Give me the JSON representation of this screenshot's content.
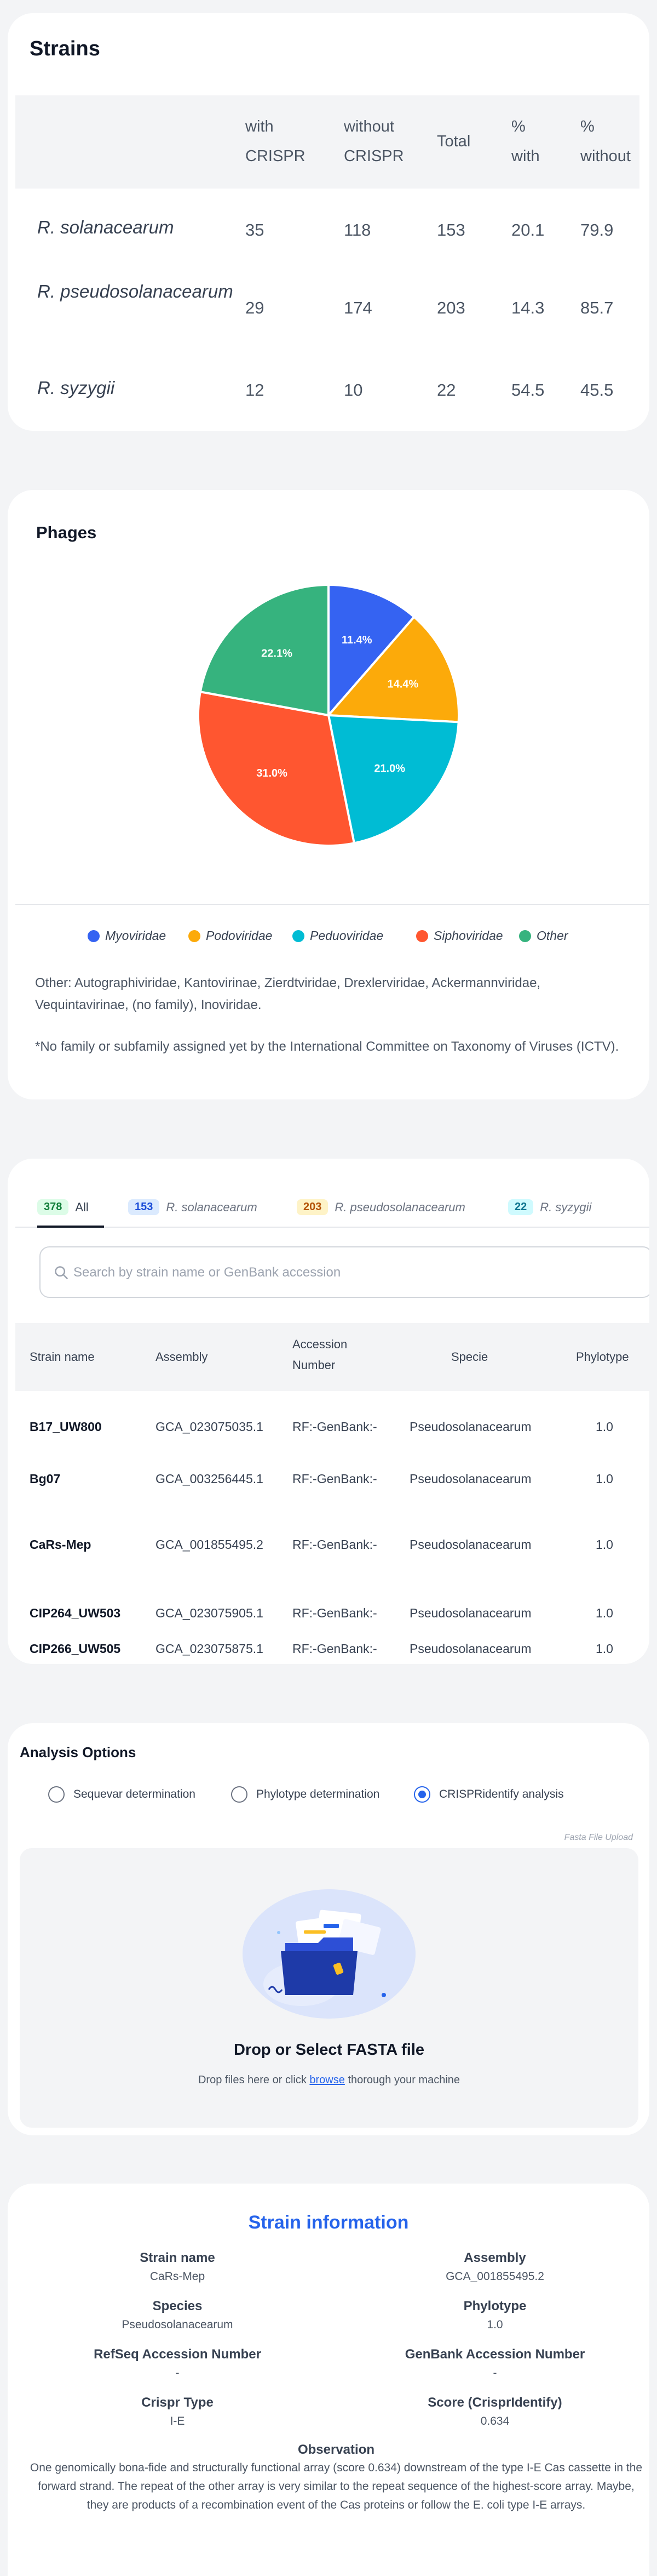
{
  "strains": {
    "title": "Strains",
    "columns": [
      "with CRISPR",
      "without CRISPR",
      "Total",
      "% with",
      "% without"
    ],
    "rows": [
      {
        "name": "R. solanacearum",
        "with": "35",
        "without": "118",
        "total": "153",
        "pct_with": "20.1",
        "pct_without": "79.9"
      },
      {
        "name": "R. pseudosolanacearum",
        "with": "29",
        "without": "174",
        "total": "203",
        "pct_with": "14.3",
        "pct_without": "85.7"
      },
      {
        "name": "R. syzygii",
        "with": "12",
        "without": "10",
        "total": "22",
        "pct_with": "54.5",
        "pct_without": "45.5"
      }
    ]
  },
  "phages": {
    "title": "Phages",
    "other_note": "Other: Autographiviridae, Kantovirinae, Zierdtviridae, Drexlerviridae, Ackermannviridae, Vequintavirinae, (no family), Inoviridae.",
    "footnote": "*No family or subfamily assigned yet by the International Committee on Taxonomy of Viruses (ICTV)."
  },
  "chart_data": {
    "type": "pie",
    "title": "Phages",
    "categories": [
      "Myoviridae",
      "Podoviridae",
      "Peduoviridae",
      "Siphoviridae",
      "Other"
    ],
    "values": [
      11.4,
      14.4,
      21.0,
      31.0,
      22.1
    ],
    "labels": [
      "11.4%",
      "14.4%",
      "21.0%",
      "31.0%",
      "22.1%"
    ],
    "colors": [
      "#3563f2",
      "#fcaa0a",
      "#00bcd4",
      "#ff5630",
      "#36b37e"
    ],
    "legend_position": "bottom"
  },
  "table": {
    "tabs": [
      {
        "count": "378",
        "label": "All"
      },
      {
        "count": "153",
        "label": "R. solanacearum"
      },
      {
        "count": "203",
        "label": "R. pseudosolanacearum"
      },
      {
        "count": "22",
        "label": "R. syzygii"
      }
    ],
    "search_placeholder": "Search by strain name or GenBank accession",
    "headers": {
      "strain": "Strain name",
      "assembly": "Assembly",
      "accession_1": "Accession",
      "accession_2": "Number",
      "specie": "Specie",
      "phylotype": "Phylotype"
    },
    "rows": [
      {
        "strain": "B17_UW800",
        "assembly": "GCA_023075035.1",
        "accession": "RF:-GenBank:-",
        "specie": "Pseudosolanacearum",
        "phylotype": "1.0"
      },
      {
        "strain": "Bg07",
        "assembly": "GCA_003256445.1",
        "accession": "RF:-GenBank:-",
        "specie": "Pseudosolanacearum",
        "phylotype": "1.0"
      },
      {
        "strain": "CaRs-Mep",
        "assembly": "GCA_001855495.2",
        "accession": "RF:-GenBank:-",
        "specie": "Pseudosolanacearum",
        "phylotype": "1.0"
      },
      {
        "strain": "CIP264_UW503",
        "assembly": "GCA_023075905.1",
        "accession": "RF:-GenBank:-",
        "specie": "Pseudosolanacearum",
        "phylotype": "1.0"
      },
      {
        "strain": "CIP266_UW505",
        "assembly": "GCA_023075875.1",
        "accession": "RF:-GenBank:-",
        "specie": "Pseudosolanacearum",
        "phylotype": "1.0"
      }
    ]
  },
  "analysis": {
    "title": "Analysis Options",
    "options": [
      "Sequevar determination",
      "Phylotype determination",
      "CRISPRidentify analysis"
    ],
    "selected": "CRISPRidentify analysis",
    "file_label": "Fasta File Upload",
    "drop_title": "Drop or Select FASTA file",
    "drop_text_before": "Drop files here or click",
    "drop_link": "browse",
    "drop_text_after": "thorough your machine"
  },
  "info": {
    "title": "Strain information",
    "strain_name_label": "Strain name",
    "strain_name": "CaRs-Mep",
    "assembly_label": "Assembly",
    "assembly": "GCA_001855495.2",
    "species_label": "Species",
    "species": "Pseudosolanacearum",
    "phylotype_label": "Phylotype",
    "phylotype": "1.0",
    "refseq_label": "RefSeq Accession Number",
    "refseq": "-",
    "genbank_label": "GenBank Accession Number",
    "genbank": "-",
    "crispr_type_label": "Crispr Type",
    "crispr_type": "I-E",
    "score_label": "Score (CrisprIdentify)",
    "score": "0.634",
    "observation_label": "Observation",
    "observation": "One genomically bona-fide and structurally functional array (score 0.634) downstream of the type I-E Cas cassette in the forward strand. The repeat of the other array is very similar to the repeat sequence of the highest-score array. Maybe, they are products of a recombination event of the Cas proteins or follow the E. coli type I-E arrays."
  }
}
